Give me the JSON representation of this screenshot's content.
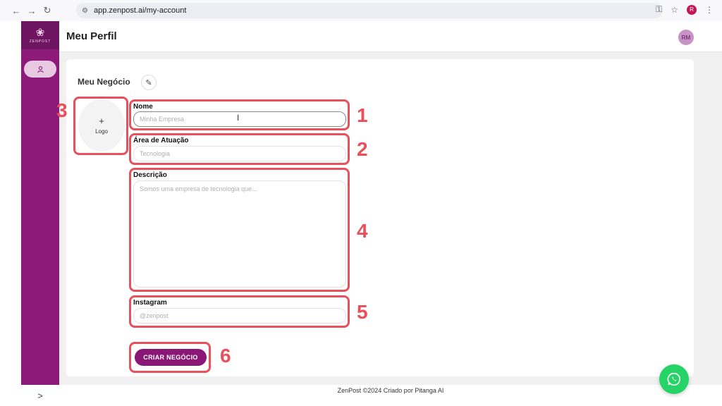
{
  "browser": {
    "url": "app.zenpost.ai/my-account",
    "profile_initial": "R"
  },
  "sidebar": {
    "brand": "ZENPOST",
    "expand_glyph": ">"
  },
  "header": {
    "title": "Meu Perfil",
    "avatar_initials": "RM"
  },
  "form": {
    "title": "Meu Negócio",
    "logo_label": "Logo",
    "fields": {
      "nome": {
        "label": "Nome",
        "placeholder": "Minha Empresa"
      },
      "area": {
        "label": "Área de Atuação",
        "placeholder": "Tecnologia"
      },
      "descricao": {
        "label": "Descrição",
        "placeholder": "Somos uma empresa de tecnologia que..."
      },
      "instagram": {
        "label": "Instagram",
        "placeholder": "@zenpost"
      }
    },
    "submit_label": "CRIAR NEGÓCIO"
  },
  "annotations": [
    "1",
    "2",
    "3",
    "4",
    "5",
    "6"
  ],
  "footer": {
    "text": "ZenPost ©2024 Criado por Pitanga AI"
  },
  "colors": {
    "brand_purple": "#8e1a78",
    "annotation_red": "#e8505b",
    "whatsapp_green": "#25d366"
  }
}
